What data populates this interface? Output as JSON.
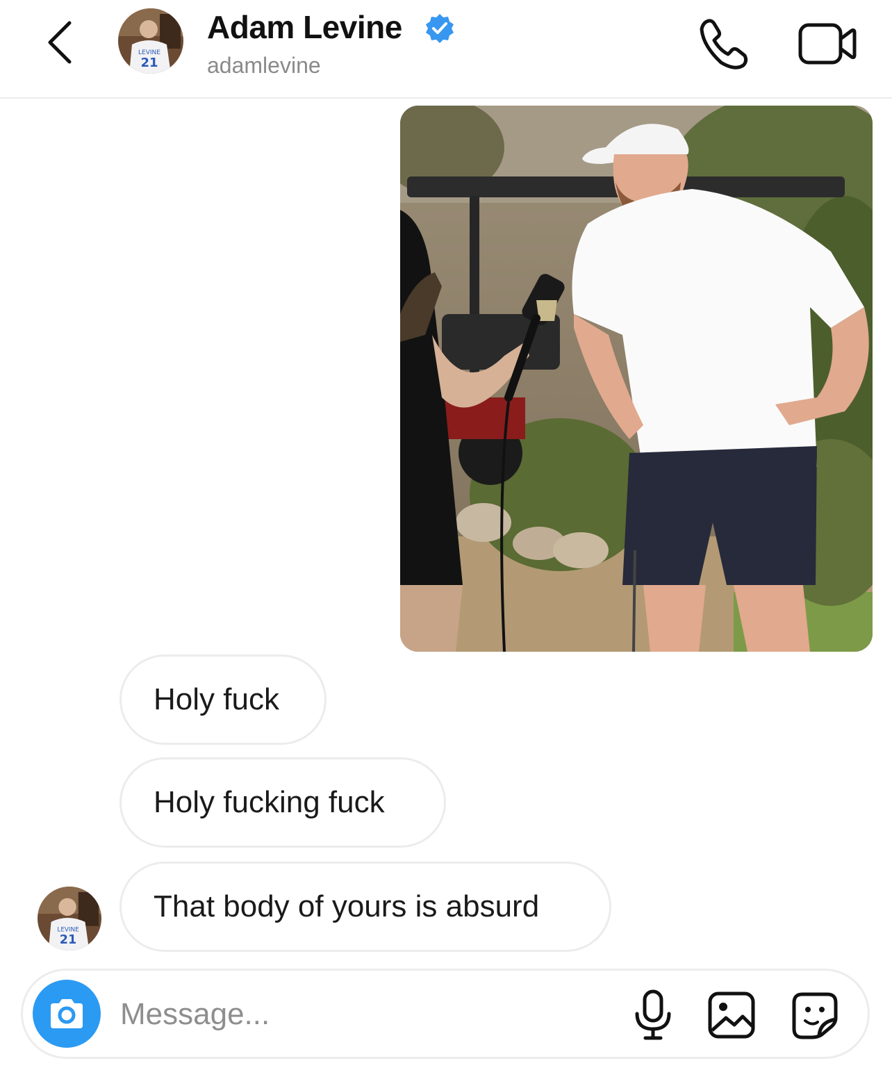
{
  "header": {
    "name": "Adam Levine",
    "handle": "adamlevine",
    "verified": true,
    "avatar_jersey_text": "LEVINE 21",
    "icons": [
      "back-arrow-icon",
      "verified-badge-icon",
      "phone-call-icon",
      "video-call-icon"
    ]
  },
  "conversation": {
    "photo_message": {
      "description_icons": [
        "photo-attachment"
      ]
    },
    "messages": [
      {
        "text": "Holy fuck"
      },
      {
        "text": "Holy fucking fuck"
      },
      {
        "text": "That body of yours is absurd"
      }
    ]
  },
  "composer": {
    "placeholder": "Message...",
    "value": "",
    "icons": [
      "camera-icon",
      "microphone-icon",
      "gallery-icon",
      "sticker-icon"
    ]
  },
  "colors": {
    "accent": "#2b9af3",
    "verified": "#3897f0",
    "bubble_border": "#ececec",
    "handle_text": "#8a8a8a"
  }
}
